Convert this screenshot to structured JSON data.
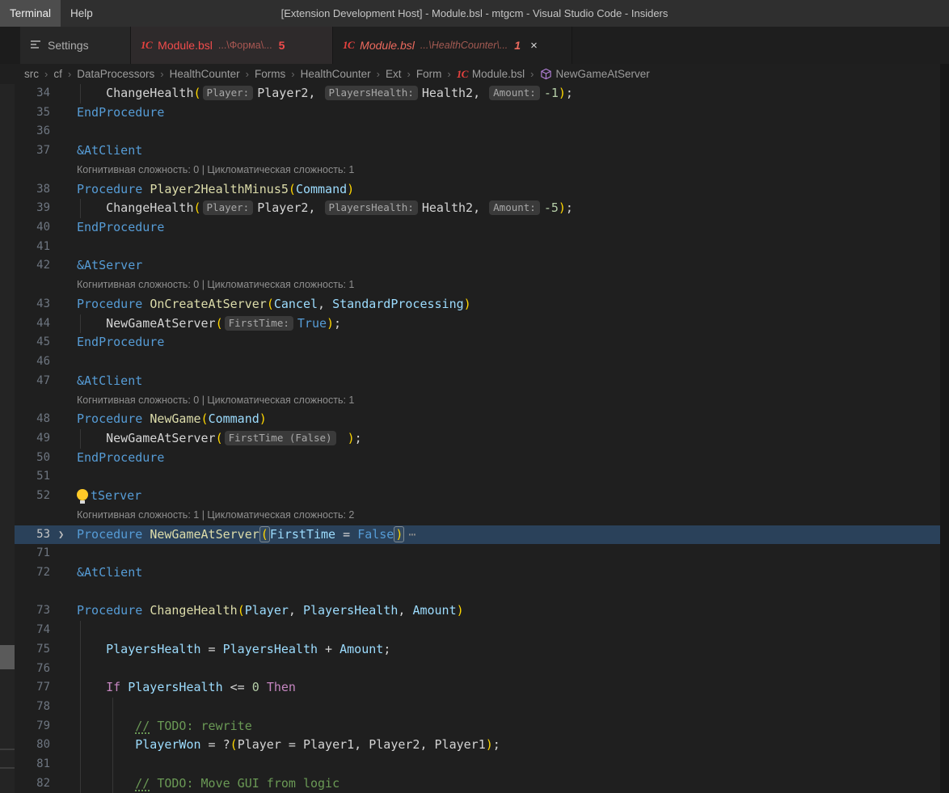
{
  "window": {
    "title": "[Extension Development Host] - Module.bsl - mtgcm - Visual Studio Code - Insiders",
    "menus": [
      {
        "label": "Terminal",
        "active": true
      },
      {
        "label": "Help",
        "active": false
      }
    ]
  },
  "tabs": [
    {
      "label": "Settings",
      "icon": "settings-sliders-icon"
    },
    {
      "label": "Module.bsl",
      "description": "...\\Форма\\...",
      "badge": "5",
      "icon": "1c-icon",
      "state": "inactive-with-errors"
    },
    {
      "label": "Module.bsl",
      "description": "...\\HealthCounter\\...",
      "badge": "1",
      "icon": "1c-icon",
      "state": "active-preview-with-errors",
      "close_label": "×"
    }
  ],
  "breadcrumbs": {
    "items": [
      {
        "label": "src"
      },
      {
        "label": "cf"
      },
      {
        "label": "DataProcessors"
      },
      {
        "label": "HealthCounter"
      },
      {
        "label": "Forms"
      },
      {
        "label": "HealthCounter"
      },
      {
        "label": "Ext"
      },
      {
        "label": "Form"
      },
      {
        "label": "Module.bsl",
        "icon": "1c-icon"
      },
      {
        "label": "NewGameAtServer",
        "icon": "method-cube-icon"
      }
    ]
  },
  "editor": {
    "language": "bsl",
    "codelens_a": "Когнитивная сложность: 0 | Цикломатическая сложность: 1",
    "codelens_b": "Когнитивная сложность: 1 | Цикломатическая сложность: 2",
    "rows": [
      {
        "n": "34",
        "g": [
          4
        ],
        "t": [
          [
            "txt",
            "    ChangeHealth"
          ],
          [
            "par",
            "("
          ],
          [
            "hint",
            "Player:"
          ],
          [
            "txt",
            "Player2, "
          ],
          [
            "hint",
            "PlayersHealth:"
          ],
          [
            "txt",
            "Health2, "
          ],
          [
            "hint",
            "Amount:"
          ],
          [
            "num",
            "-1"
          ],
          [
            "par",
            ")"
          ],
          [
            "txt",
            ";"
          ]
        ]
      },
      {
        "n": "35",
        "t": [
          [
            "kw",
            "EndProcedure"
          ]
        ]
      },
      {
        "n": "36",
        "t": []
      },
      {
        "n": "37",
        "t": [
          [
            "kw",
            "&AtClient"
          ]
        ]
      },
      {
        "lens": "Когнитивная сложность: 0 | Цикломатическая сложность: 1"
      },
      {
        "n": "38",
        "t": [
          [
            "kw",
            "Procedure "
          ],
          [
            "fn",
            "Player2HealthMinus5"
          ],
          [
            "par",
            "("
          ],
          [
            "var",
            "Command"
          ],
          [
            "par",
            ")"
          ]
        ]
      },
      {
        "n": "39",
        "g": [
          4
        ],
        "t": [
          [
            "txt",
            "    ChangeHealth"
          ],
          [
            "par",
            "("
          ],
          [
            "hint",
            "Player:"
          ],
          [
            "txt",
            "Player2, "
          ],
          [
            "hint",
            "PlayersHealth:"
          ],
          [
            "txt",
            "Health2, "
          ],
          [
            "hint",
            "Amount:"
          ],
          [
            "num",
            "-5"
          ],
          [
            "par",
            ")"
          ],
          [
            "txt",
            ";"
          ]
        ]
      },
      {
        "n": "40",
        "t": [
          [
            "kw",
            "EndProcedure"
          ]
        ]
      },
      {
        "n": "41",
        "t": []
      },
      {
        "n": "42",
        "t": [
          [
            "kw",
            "&AtServer"
          ]
        ]
      },
      {
        "lens": "Когнитивная сложность: 0 | Цикломатическая сложность: 1"
      },
      {
        "n": "43",
        "t": [
          [
            "kw",
            "Procedure "
          ],
          [
            "fn",
            "OnCreateAtServer"
          ],
          [
            "par",
            "("
          ],
          [
            "var",
            "Cancel"
          ],
          [
            "txt",
            ", "
          ],
          [
            "var",
            "StandardProcessing"
          ],
          [
            "par",
            ")"
          ]
        ]
      },
      {
        "n": "44",
        "g": [
          4
        ],
        "t": [
          [
            "txt",
            "    NewGameAtServer"
          ],
          [
            "par",
            "("
          ],
          [
            "hint",
            "FirstTime:"
          ],
          [
            "kw",
            "True"
          ],
          [
            "par",
            ")"
          ],
          [
            "txt",
            ";"
          ]
        ]
      },
      {
        "n": "45",
        "t": [
          [
            "kw",
            "EndProcedure"
          ]
        ]
      },
      {
        "n": "46",
        "t": []
      },
      {
        "n": "47",
        "t": [
          [
            "kw",
            "&AtClient"
          ]
        ]
      },
      {
        "lens": "Когнитивная сложность: 0 | Цикломатическая сложность: 1"
      },
      {
        "n": "48",
        "t": [
          [
            "kw",
            "Procedure "
          ],
          [
            "fn",
            "NewGame"
          ],
          [
            "par",
            "("
          ],
          [
            "var",
            "Command"
          ],
          [
            "par",
            ")"
          ]
        ]
      },
      {
        "n": "49",
        "g": [
          4
        ],
        "t": [
          [
            "txt",
            "    NewGameAtServer"
          ],
          [
            "par",
            "("
          ],
          [
            "hint",
            "FirstTime (False)"
          ],
          [
            "txt",
            " "
          ],
          [
            "par",
            ")"
          ],
          [
            "txt",
            ";"
          ]
        ]
      },
      {
        "n": "50",
        "t": [
          [
            "kw",
            "EndProcedure"
          ]
        ]
      },
      {
        "n": "51",
        "t": []
      },
      {
        "n": "52",
        "t": [
          [
            "bulb",
            ""
          ],
          [
            "kw",
            "tServer"
          ]
        ]
      },
      {
        "lens": "Когнитивная сложность: 1 | Цикломатическая сложность: 2"
      },
      {
        "n": "53",
        "hl": true,
        "fold": true,
        "t": [
          [
            "kw",
            "Procedure "
          ],
          [
            "fn",
            "NewGameAtServer"
          ],
          [
            "bpar",
            "("
          ],
          [
            "var",
            "FirstTime"
          ],
          [
            "txt",
            " = "
          ],
          [
            "kw",
            "False"
          ],
          [
            "bpar",
            ")"
          ],
          [
            "dots",
            "⋯"
          ]
        ]
      },
      {
        "n": "71",
        "t": []
      },
      {
        "n": "72",
        "t": [
          [
            "kw",
            "&AtClient"
          ]
        ]
      },
      {
        "sp": true
      },
      {
        "n": "73",
        "t": [
          [
            "kw",
            "Procedure "
          ],
          [
            "fn",
            "ChangeHealth"
          ],
          [
            "par",
            "("
          ],
          [
            "var",
            "Player"
          ],
          [
            "txt",
            ", "
          ],
          [
            "var",
            "PlayersHealth"
          ],
          [
            "txt",
            ", "
          ],
          [
            "var",
            "Amount"
          ],
          [
            "par",
            ")"
          ]
        ]
      },
      {
        "n": "74",
        "g": [
          4
        ],
        "t": []
      },
      {
        "n": "75",
        "g": [
          4
        ],
        "t": [
          [
            "txt",
            "    "
          ],
          [
            "var",
            "PlayersHealth"
          ],
          [
            "txt",
            " = "
          ],
          [
            "var",
            "PlayersHealth"
          ],
          [
            "txt",
            " + "
          ],
          [
            "var",
            "Amount"
          ],
          [
            "txt",
            ";"
          ]
        ]
      },
      {
        "n": "76",
        "g": [
          4
        ],
        "t": []
      },
      {
        "n": "77",
        "g": [
          4
        ],
        "t": [
          [
            "txt",
            "    "
          ],
          [
            "ctrl",
            "If"
          ],
          [
            "txt",
            " "
          ],
          [
            "var",
            "PlayersHealth"
          ],
          [
            "txt",
            " <= "
          ],
          [
            "num",
            "0"
          ],
          [
            "txt",
            " "
          ],
          [
            "ctrl",
            "Then"
          ]
        ]
      },
      {
        "n": "78",
        "g": [
          4,
          44
        ],
        "t": []
      },
      {
        "n": "79",
        "g": [
          4,
          44
        ],
        "t": [
          [
            "txt",
            "        "
          ],
          [
            "cmtu",
            "//"
          ],
          [
            "cmt",
            " TODO: rewrite"
          ]
        ]
      },
      {
        "n": "80",
        "g": [
          4,
          44
        ],
        "t": [
          [
            "txt",
            "        "
          ],
          [
            "var",
            "PlayerWon"
          ],
          [
            "txt",
            " = ?"
          ],
          [
            "par",
            "("
          ],
          [
            "txt",
            "Player = Player1, Player2, Player1"
          ],
          [
            "par",
            ")"
          ],
          [
            "txt",
            ";"
          ]
        ]
      },
      {
        "n": "81",
        "g": [
          4,
          44
        ],
        "t": []
      },
      {
        "n": "82",
        "g": [
          4,
          44
        ],
        "t": [
          [
            "txt",
            "        "
          ],
          [
            "cmtu",
            "//"
          ],
          [
            "cmt",
            " TODO: Move GUI from logic"
          ]
        ]
      }
    ]
  },
  "theme": {
    "editor_background": "#1f1f1f",
    "titlebar_background": "#2f2f2f",
    "keyword": "#569cd6",
    "function_name": "#dcdcaa",
    "variable": "#9cdcfe",
    "control_keyword": "#c586c0",
    "number": "#b5cea8",
    "comment": "#6a9955",
    "plain_text": "#d4d4d4",
    "bracket": "#ffd700",
    "error_red": "#f14c4c",
    "codelens": "#8f8f8f",
    "line_number": "#6e7681",
    "current_line_background": "#2a415a",
    "inlay_hint_background": "#3a3a3a",
    "inlay_hint_foreground": "#a8a8a8",
    "method_icon_purple": "#b180d7",
    "lightbulb_yellow": "#ffca28"
  }
}
